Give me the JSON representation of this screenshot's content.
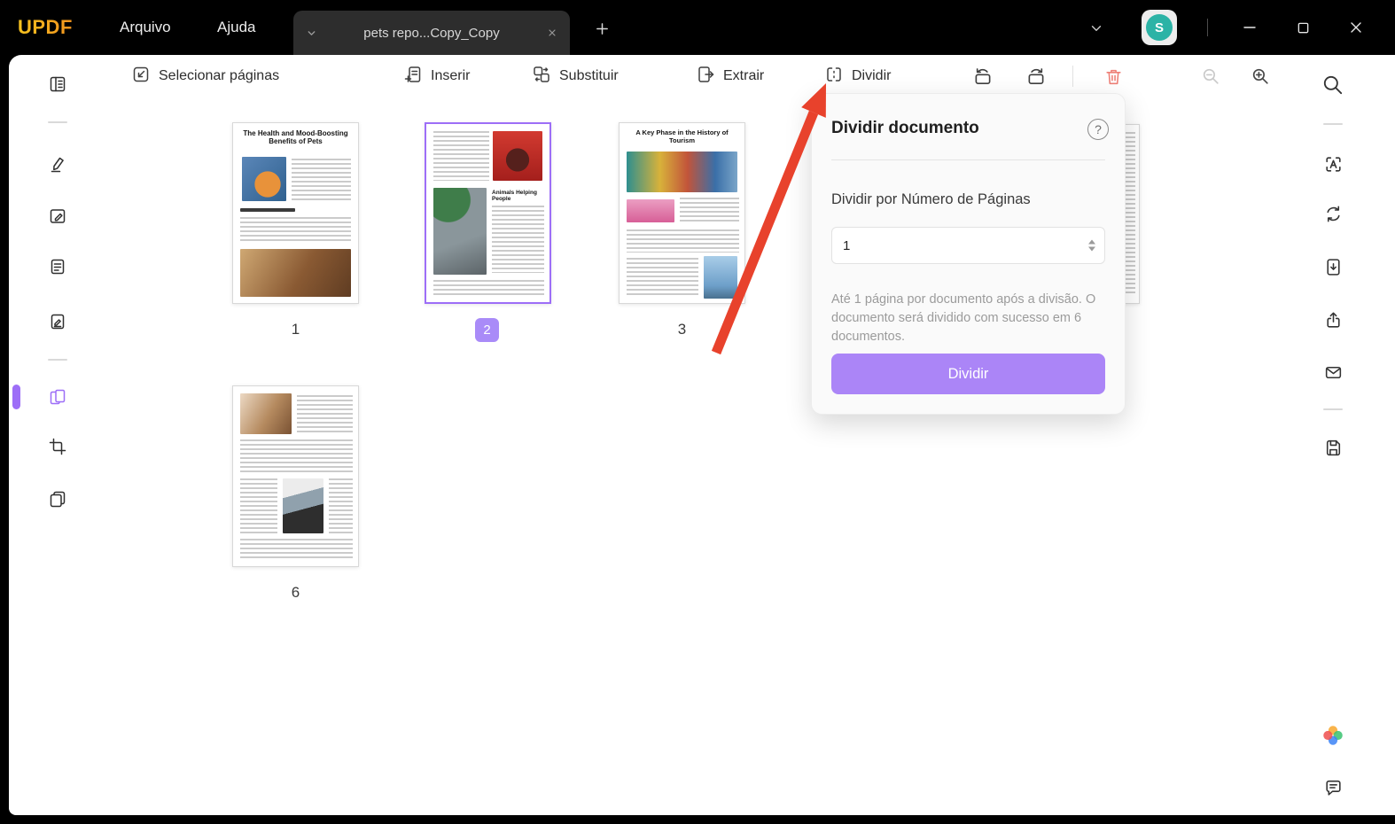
{
  "window": {
    "logo": "UPDF",
    "menus": {
      "file": "Arquivo",
      "help": "Ajuda"
    },
    "tab_title": "pets repo...Copy_Copy",
    "avatar_initial": "S"
  },
  "toolbar": {
    "select_pages": "Selecionar páginas",
    "insert": "Inserir",
    "replace": "Substituir",
    "extract": "Extrair",
    "split": "Dividir"
  },
  "thumbnails": {
    "pages": [
      {
        "number": "1",
        "selected": false,
        "headline": "The Health and Mood-Boosting Benefits of Pets"
      },
      {
        "number": "2",
        "selected": true,
        "headline": "Animals Helping People"
      },
      {
        "number": "3",
        "selected": false,
        "headline": "A Key Phase in the History of Tourism"
      },
      {
        "number": "6",
        "selected": false,
        "headline": ""
      }
    ]
  },
  "split_panel": {
    "title": "Dividir documento",
    "help_glyph": "?",
    "section_label": "Dividir por Número de Páginas",
    "input_value": "1",
    "helper_text": "Até 1 página por documento após a divisão. O documento será dividido com sucesso em 6 documentos.",
    "button_label": "Dividir"
  },
  "colors": {
    "accent_purple": "#ab85f7",
    "selection_purple": "#9d6ef7",
    "arrow_red": "#e8422c",
    "avatar_teal": "#2cb3a6",
    "trash_red": "#ee7f76"
  }
}
